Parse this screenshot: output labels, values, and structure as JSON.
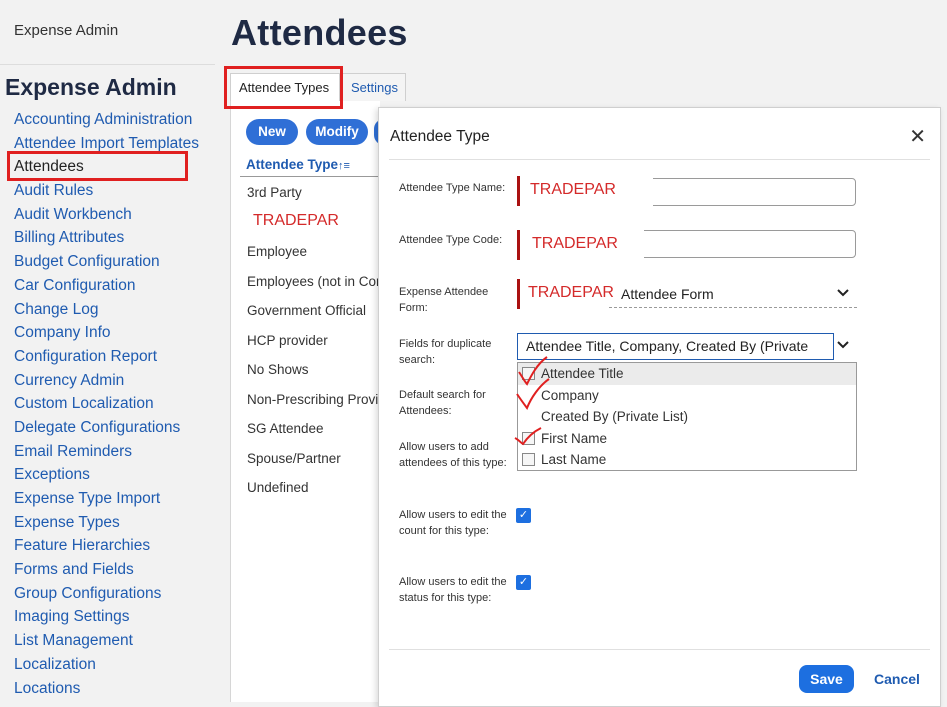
{
  "breadcrumb": "Expense Admin",
  "sidebar": {
    "heading": "Expense Admin",
    "items": [
      "Accounting Administration",
      "Attendee Import Templates",
      "Attendees",
      "Audit Rules",
      "Audit Workbench",
      "Billing Attributes",
      "Budget Configuration",
      "Car Configuration",
      "Change Log",
      "Company Info",
      "Configuration Report",
      "Currency Admin",
      "Custom Localization",
      "Delegate Configurations",
      "Email Reminders",
      "Exceptions",
      "Expense Type Import",
      "Expense Types",
      "Feature Hierarchies",
      "Forms and Fields",
      "Group Configurations",
      "Imaging Settings",
      "List Management",
      "Localization",
      "Locations"
    ]
  },
  "page_title": "Attendees",
  "tabs": [
    "Attendee Types",
    "Settings"
  ],
  "toolbar": {
    "new_label": "New",
    "modify_label": "Modify"
  },
  "table": {
    "column_header": "Attendee Type",
    "sort_icon": "↑≡",
    "rows": [
      "3rd Party",
      "TRADEPAR",
      "Employee",
      "Employees (not in Concur)",
      "Government Official",
      "HCP provider",
      "No Shows",
      "Non-Prescribing Provider",
      "SG Attendee",
      "Spouse/Partner",
      "Undefined"
    ]
  },
  "modal": {
    "title": "Attendee Type",
    "close_icon": "✕",
    "fields": {
      "name_label": "Attendee Type Name:",
      "name_value": "TRADEPAR",
      "code_label": "Attendee Type Code:",
      "code_value": "TRADEPAR",
      "form_label": "Expense Attendee Form:",
      "form_prefix": "TRADEPAR",
      "form_value": "Attendee Form",
      "dup_label": "Fields for duplicate search:",
      "dup_value": "Attendee Title, Company, Created By (Private List)",
      "default_search_label": "Default search for Attendees:",
      "allow_add_label": "Allow users to add attendees of this type:",
      "allow_edit_count_label": "Allow users to edit the count for this type:",
      "allow_edit_status_label": "Allow users to edit the status for this type:"
    },
    "dropdown_options": [
      "Attendee Title",
      "Company",
      "Created By (Private List)",
      "First Name",
      "Last Name"
    ],
    "checkmark_glyph": "✓",
    "save_label": "Save",
    "cancel_label": "Cancel"
  },
  "colors": {
    "accent": "#1d6fe0",
    "annotation_red": "#e02020",
    "link": "#1f5bb0"
  }
}
